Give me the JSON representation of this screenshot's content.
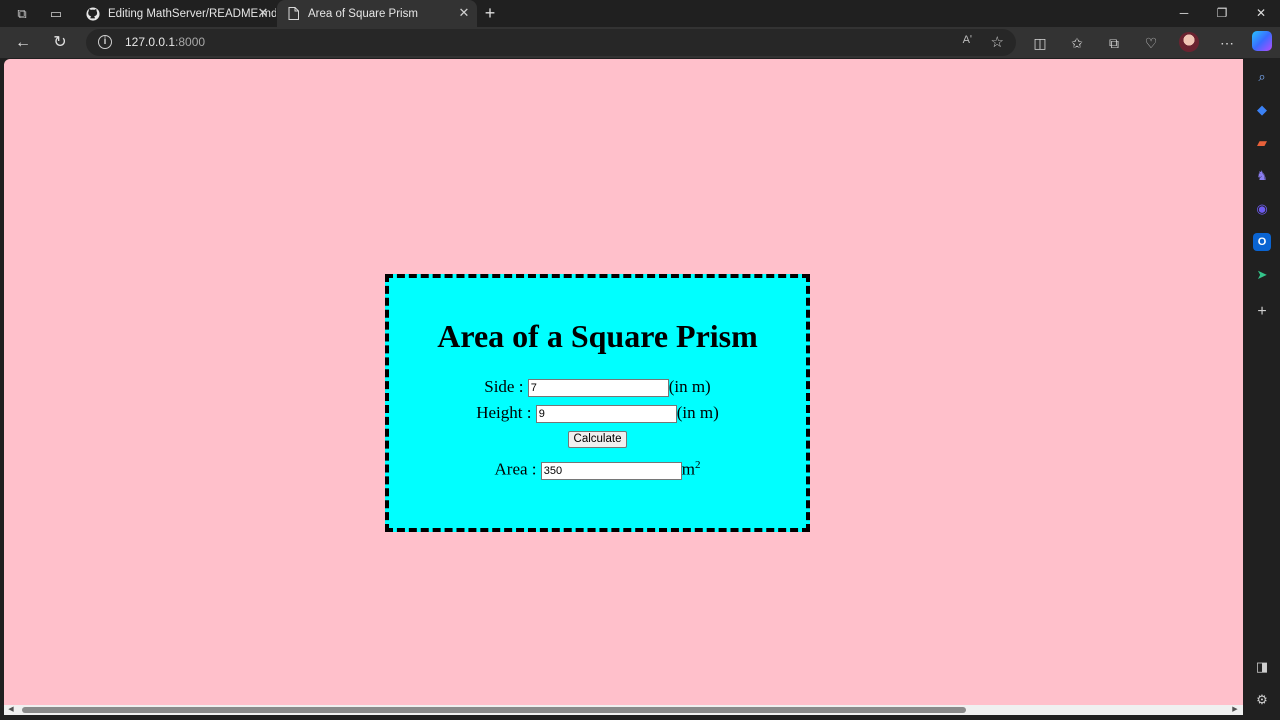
{
  "browser": {
    "tabs": [
      {
        "title": "Editing MathServer/README.md",
        "icon": "github-icon",
        "active": false
      },
      {
        "title": "Area of Square Prism",
        "icon": "page-icon",
        "active": true
      }
    ],
    "url_host": "127.0.0.1",
    "url_port": ":8000",
    "read_aloud": "Aʹ"
  },
  "page": {
    "title": "Area of a Square Prism",
    "side_label": "Side :",
    "side_value": "7",
    "side_unit": "(in m)",
    "height_label": "Height :",
    "height_value": "9",
    "height_unit": "(in m)",
    "calculate_label": "Calculate",
    "area_label": "Area :",
    "area_value": "350",
    "area_unit": "m",
    "area_unit_exp": "2"
  },
  "colors": {
    "page_background": "#ffc0cb",
    "card_background": "#00ffff",
    "card_border": "#000000"
  }
}
